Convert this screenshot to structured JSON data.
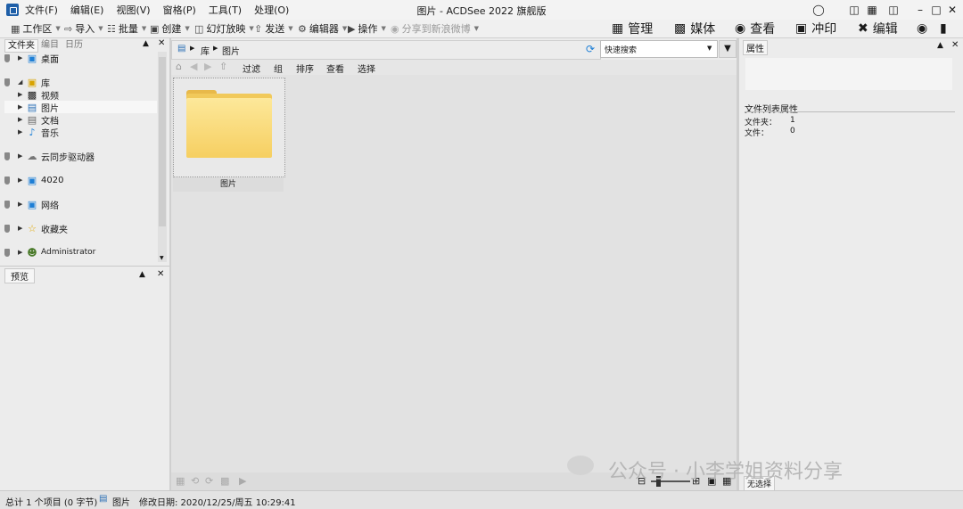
{
  "window": {
    "title": "图片 - ACDSee 2022 旗舰版"
  },
  "menu": [
    "文件(F)",
    "编辑(E)",
    "视图(V)",
    "窗格(P)",
    "工具(T)",
    "处理(O)"
  ],
  "toolbar": {
    "workspace": "工作区",
    "import": "导入",
    "batch": "批量",
    "create": "创建",
    "slideshow": "幻灯放映",
    "send": "发送",
    "editor": "编辑器",
    "actions": "操作",
    "share": "分享到新浪微博"
  },
  "modes": {
    "manage": "管理",
    "media": "媒体",
    "view": "查看",
    "develop": "冲印",
    "edit": "编辑"
  },
  "left_panel": {
    "tabs": [
      "文件夹",
      "编目",
      "日历"
    ],
    "tree": {
      "desktop": "桌面",
      "library": "库",
      "library_children": [
        "视频",
        "图片",
        "文档",
        "音乐"
      ],
      "cloud": "云同步驱动器",
      "pc": "4020",
      "network": "网络",
      "favorites": "收藏夹",
      "admin": "Administrator"
    },
    "preview_title": "预览"
  },
  "address": {
    "root": "库",
    "current": "图片"
  },
  "search": {
    "placeholder": "快速搜索"
  },
  "nav": {
    "filter": "过滤",
    "group": "组",
    "sort": "排序",
    "view": "查看",
    "select": "选择"
  },
  "thumbnail": {
    "label": "图片"
  },
  "right_panel": {
    "title": "属性",
    "section": "文件列表属性",
    "folders_label": "文件夹：",
    "folders_value": "1",
    "files_label": "文件：",
    "files_value": "0",
    "no_selection": "无选择"
  },
  "status": {
    "total": "总计 1 个项目 (0 字节)",
    "location": "图片",
    "modified": "修改日期: 2020/12/25/周五 10:29:41"
  },
  "watermark": "公众号 · 小李学姐资料分享"
}
